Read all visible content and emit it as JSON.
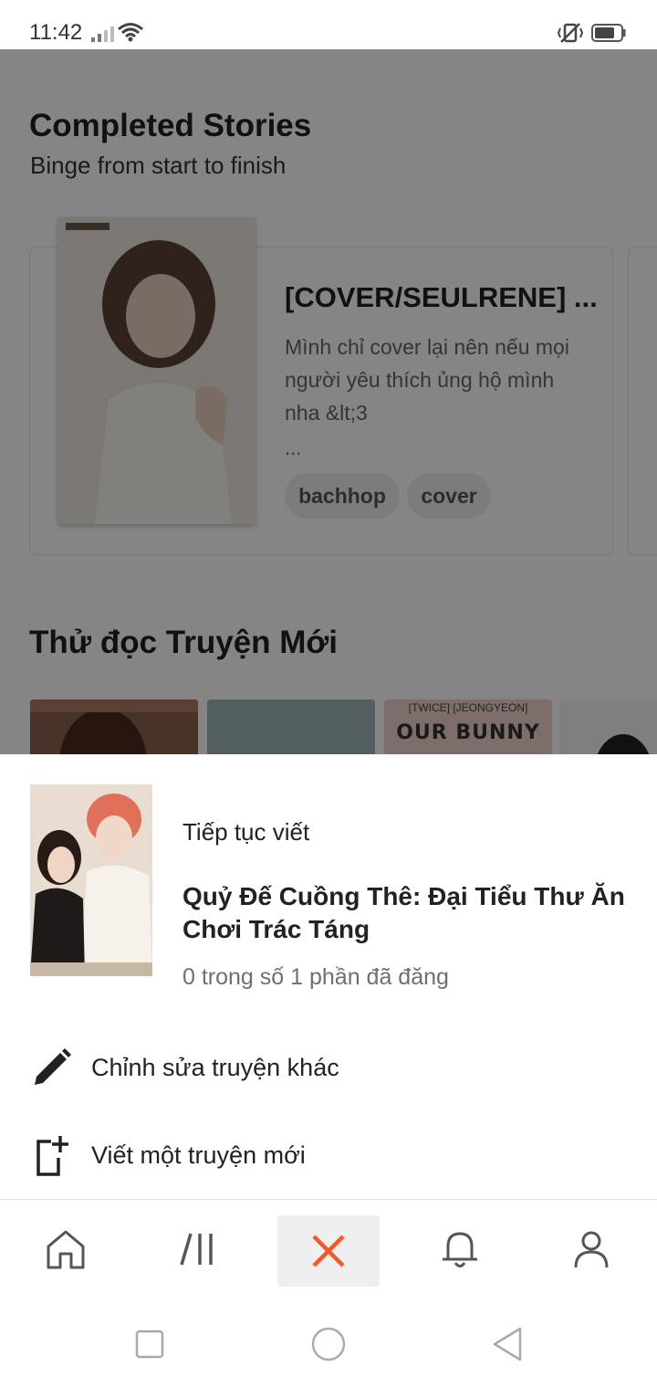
{
  "status_bar": {
    "time": "11:42"
  },
  "background": {
    "section1_title": "Completed Stories",
    "section1_subtitle": "Binge from start to finish",
    "story": {
      "title": "[COVER/SEULRENE] ...",
      "description": "Mình chỉ cover lại nên nếu mọi người yêu thích ủng hộ mình nha &lt;3",
      "more": "...",
      "tags": [
        "bachhop",
        "cover"
      ]
    },
    "section2_title": "Thử đọc Truyện Mới",
    "thumb_overlay_small": "[TWICE]  [JEONGYEON]",
    "thumb_overlay_big": "OUR BUNNY"
  },
  "sheet": {
    "continue_label": "Tiếp tục viết",
    "continue_title": "Quỷ Đế Cuồng Thê: Đại Tiểu Thư Ăn Chơi Trác Táng",
    "continue_meta": "0 trong số 1 phần đã đăng",
    "edit_other": "Chỉnh sửa truyện khác",
    "new_story": "Viết một truyện mới"
  },
  "tabbar": {
    "items": [
      "home-icon",
      "library-icon",
      "close-icon",
      "bell-icon",
      "profile-icon"
    ],
    "active_color": "#f15a2b"
  },
  "system_nav": [
    "square-icon",
    "circle-icon",
    "back-triangle-icon"
  ]
}
